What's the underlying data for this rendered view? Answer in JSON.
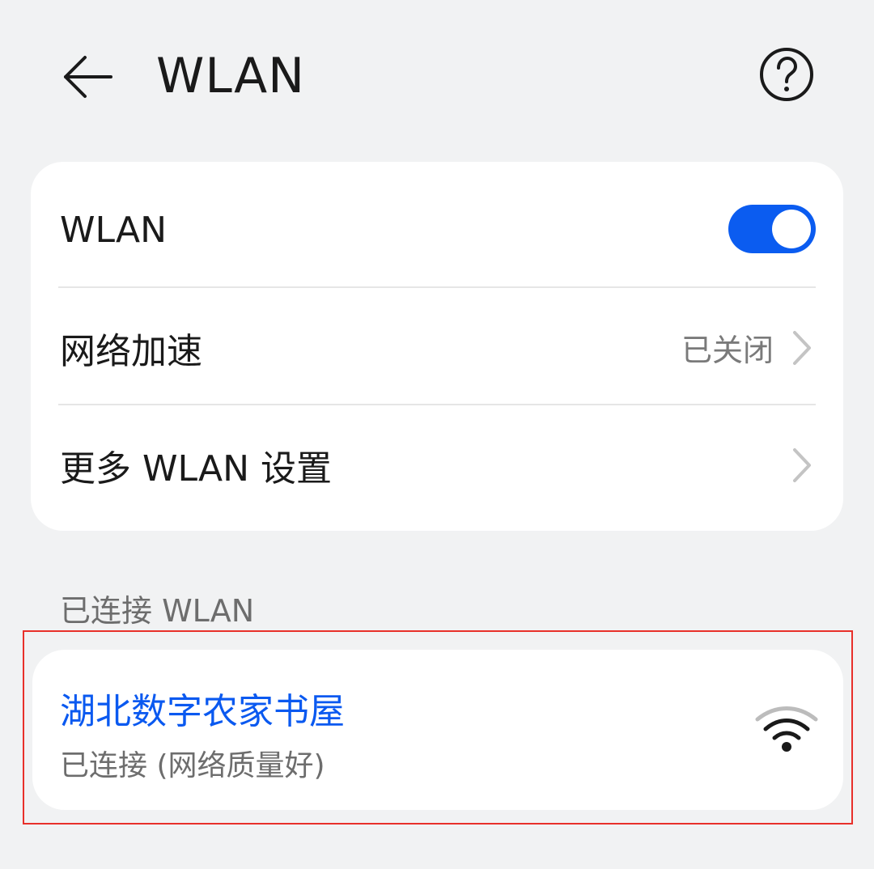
{
  "header": {
    "back_icon": "back-arrow-icon",
    "title": "WLAN",
    "help_icon": "help-circle-icon"
  },
  "settings": {
    "wlan": {
      "label": "WLAN",
      "toggle_on": true,
      "accent_color": "#0b5cf0"
    },
    "network_acceleration": {
      "label": "网络加速",
      "value": "已关闭",
      "chevron_icon": "chevron-right-icon"
    },
    "more_settings": {
      "label": "更多 WLAN 设置",
      "chevron_icon": "chevron-right-icon"
    }
  },
  "connected_section": {
    "title": "已连接 WLAN",
    "network": {
      "ssid": "湖北数字农家书屋",
      "status": "已连接 (网络质量好)",
      "signal_icon": "wifi-signal-icon",
      "ssid_color": "#0a59f0"
    }
  }
}
